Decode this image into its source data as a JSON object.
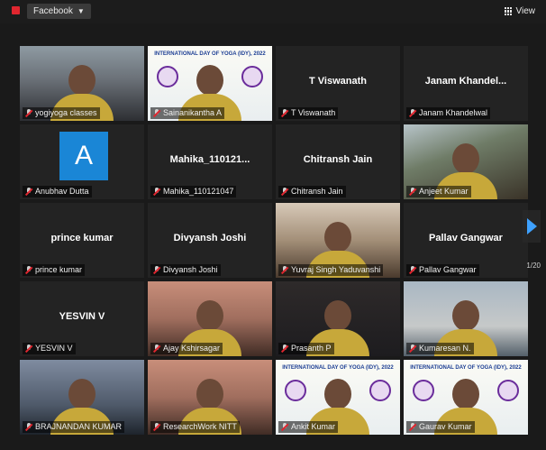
{
  "topbar": {
    "stream_label": "Facebook",
    "view_label": "View"
  },
  "pager": {
    "page": "1/20"
  },
  "participants": [
    {
      "name": "yogiyoga classes",
      "display": "",
      "video": "room",
      "active": true
    },
    {
      "name": "Sainanikantha A",
      "display": "",
      "video": "poster"
    },
    {
      "name": "T Viswanath",
      "display": "T Viswanath",
      "video": ""
    },
    {
      "name": "Janam Khandelwal",
      "display": "Janam  Khandel...",
      "video": ""
    },
    {
      "name": "Anubhav Dutta",
      "display": "",
      "video": "avatar",
      "avatar_letter": "A"
    },
    {
      "name": "Mahika_110121047",
      "display": "Mahika_110121...",
      "video": ""
    },
    {
      "name": "Chitransh Jain",
      "display": "Chitransh Jain",
      "video": ""
    },
    {
      "name": "Anjeet Kumar",
      "display": "",
      "video": "outdoor"
    },
    {
      "name": "prince kumar",
      "display": "prince kumar",
      "video": ""
    },
    {
      "name": "Divyansh Joshi",
      "display": "Divyansh Joshi",
      "video": ""
    },
    {
      "name": "Yuvraj Singh Yaduvanshi",
      "display": "",
      "video": "light"
    },
    {
      "name": "Pallav Gangwar",
      "display": "Pallav Gangwar",
      "video": ""
    },
    {
      "name": "YESVIN V",
      "display": "YESVIN V",
      "video": ""
    },
    {
      "name": "Ajay Kshirsagar",
      "display": "",
      "video": "warm"
    },
    {
      "name": "Prasanth P",
      "display": "",
      "video": "dark"
    },
    {
      "name": "Kumaresan N.",
      "display": "",
      "video": "wall"
    },
    {
      "name": "BRAJNANDAN KUMAR",
      "display": "",
      "video": "blue"
    },
    {
      "name": "ResearchWork NITT",
      "display": "",
      "video": "warm"
    },
    {
      "name": "Ankit Kumar",
      "display": "",
      "video": "poster"
    },
    {
      "name": "Gaurav Kumar",
      "display": "",
      "video": "poster"
    }
  ],
  "poster_text": "INTERNATIONAL DAY OF YOGA (IDY), 2022",
  "colors": {
    "active_border": "#e9e14b",
    "muted_mic": "#e0262f",
    "avatar_bg": "#1a86d6",
    "next_arrow": "#3ea1ff"
  }
}
